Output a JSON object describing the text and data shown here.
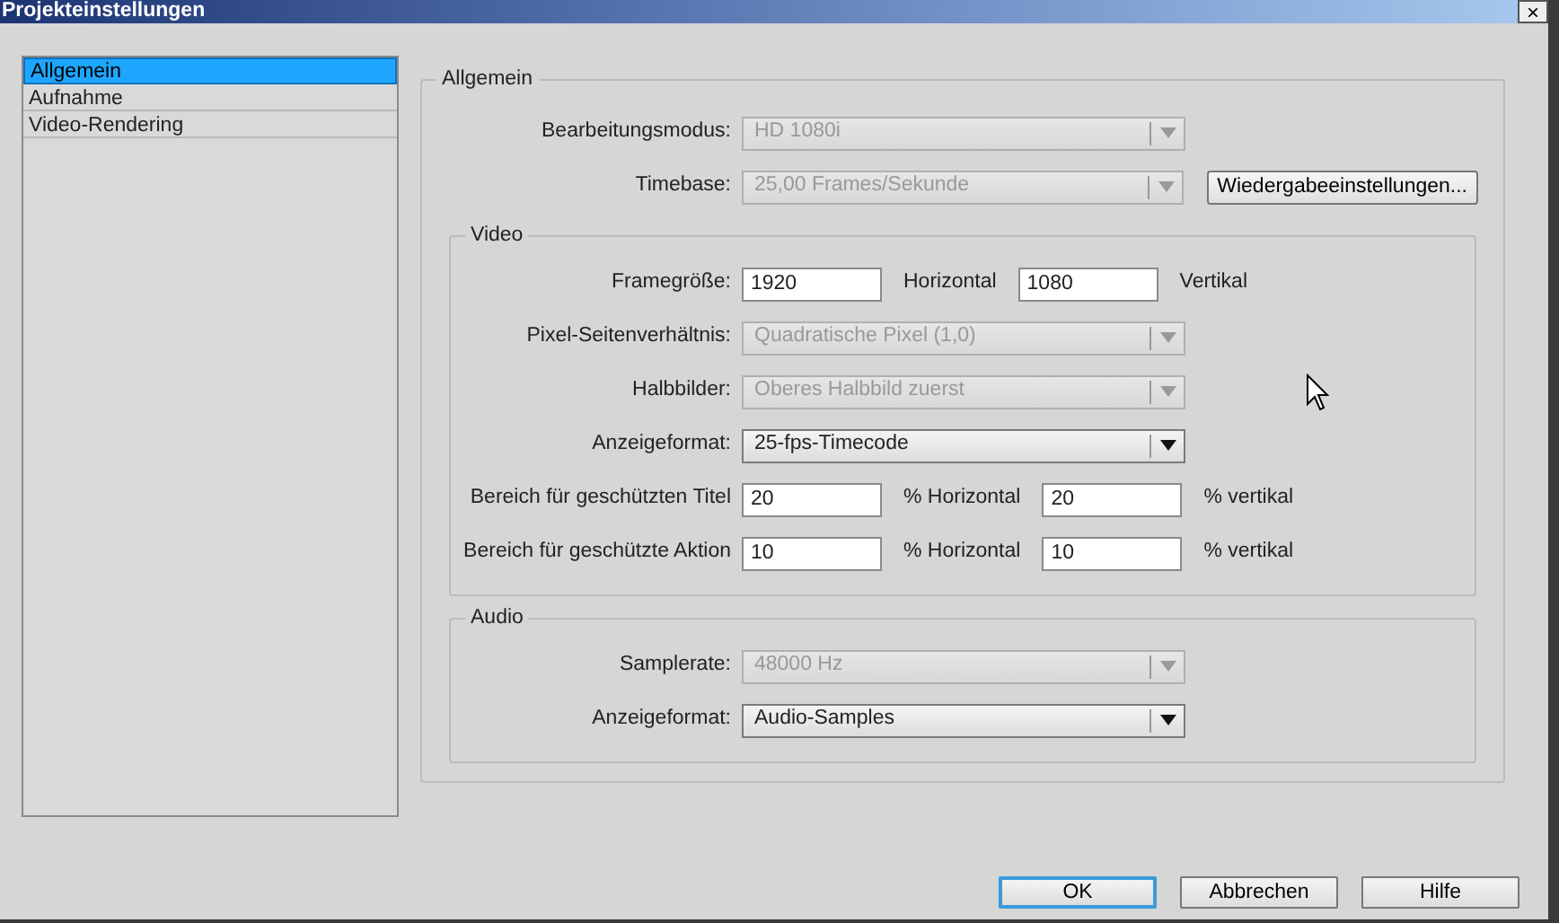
{
  "window": {
    "title": "Projekteinstellungen",
    "close_symbol": "×"
  },
  "sidebar": {
    "items": [
      {
        "label": "Allgemein",
        "selected": true
      },
      {
        "label": "Aufnahme",
        "selected": false
      },
      {
        "label": "Video-Rendering",
        "selected": false
      }
    ]
  },
  "general": {
    "title": "Allgemein",
    "rows": [
      {
        "kind": "select",
        "label": "Bearbeitungsmodus:",
        "value": "HD 1080i",
        "disabled": true
      },
      {
        "kind": "select",
        "label": "Timebase:",
        "value": "25,00 Frames/Sekunde",
        "disabled": true,
        "button": "Wiedergabeeinstellungen..."
      }
    ]
  },
  "video": {
    "title": "Video",
    "rows": [
      {
        "kind": "pair",
        "label": "Framegröße:",
        "value_1": "1920",
        "unit_1": "Horizontal",
        "value_2": "1080",
        "unit_2": "Vertikal"
      },
      {
        "kind": "select",
        "label": "Pixel-Seitenverhältnis:",
        "value": "Quadratische Pixel (1,0)",
        "disabled": true
      },
      {
        "kind": "select",
        "label": "Halbbilder:",
        "value": "Oberes Halbbild zuerst",
        "disabled": true
      },
      {
        "kind": "select",
        "label": "Anzeigeformat:",
        "value": "25-fps-Timecode",
        "disabled": false
      },
      {
        "kind": "pair",
        "label": "Bereich für geschützten Titel",
        "value_1": "20",
        "unit_1": "% Horizontal",
        "value_2": "20",
        "unit_2": "% vertikal"
      },
      {
        "kind": "pair",
        "label": "Bereich für geschützte Aktion",
        "value_1": "10",
        "unit_1": "% Horizontal",
        "value_2": "10",
        "unit_2": "% vertikal"
      }
    ]
  },
  "audio": {
    "title": "Audio",
    "rows": [
      {
        "kind": "select",
        "label": "Samplerate:",
        "value": "48000 Hz",
        "disabled": true
      },
      {
        "kind": "select",
        "label": "Anzeigeformat:",
        "value": "Audio-Samples",
        "disabled": false
      }
    ]
  },
  "buttons": [
    {
      "label": "OK",
      "default": true
    },
    {
      "label": "Abbrechen",
      "default": false
    },
    {
      "label": "Hilfe",
      "default": false
    }
  ]
}
